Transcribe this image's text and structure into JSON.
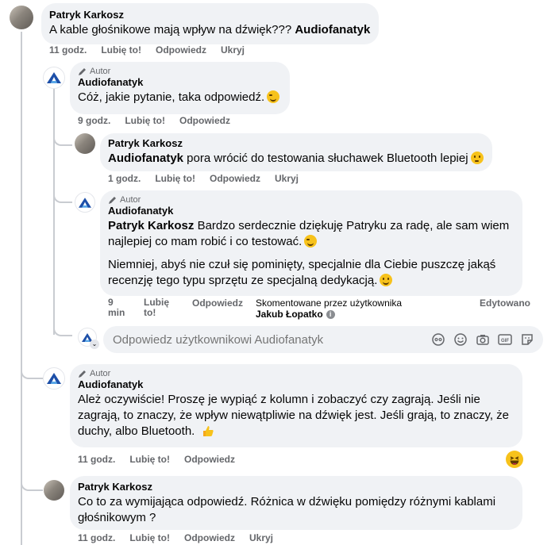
{
  "colors": {
    "bubble": "#f0f2f5",
    "meta": "#65676b",
    "thread_line": "#c9ccd1",
    "brand_blue": "#1d4fa8",
    "emoji": "#f7c21b"
  },
  "comments": [
    {
      "author": "Patryk Karkosz",
      "text": "A kable głośnikowe mają wpływ na dźwięk??? ",
      "mention": "Audiofanatyk",
      "time": "11 godz.",
      "like": "Lubię to!",
      "reply": "Odpowiedz",
      "hide": "Ukryj"
    },
    {
      "badge": "Autor",
      "author": "Audiofanatyk",
      "text": "Cóż, jakie pytanie, taka odpowiedź.",
      "time": "9 godz.",
      "like": "Lubię to!",
      "reply": "Odpowiedz"
    },
    {
      "author": "Patryk Karkosz",
      "mention": "Audiofanatyk",
      "text": " pora wrócić do testowania słuchawek Bluetooth lepiej",
      "time": "1 godz.",
      "like": "Lubię to!",
      "reply": "Odpowiedz",
      "hide": "Ukryj"
    },
    {
      "badge": "Autor",
      "author": "Audiofanatyk",
      "mention": "Patryk Karkosz",
      "text_line1": " Bardzo serdecznie dziękuję Patryku za radę, ale sam wiem",
      "text_line2": "najlepiej co mam robić i co testować.",
      "text_p2_line1": "Niemniej, abyś nie czuł się pominięty, specjalnie dla Ciebie puszczę jakąś",
      "text_p2_line2": "recenzję tego typu sprzętu ze specjalną dedykacją.",
      "time_line1": "9",
      "time_line2": "min",
      "like_line1": "Lubię",
      "like_line2": "to!",
      "reply": "Odpowiedz",
      "commented_by": "Skomentowane przez użytkownika",
      "commented_by_name": "Jakub Łopatko",
      "edited": "Edytowano"
    },
    {
      "badge": "Autor",
      "author": "Audiofanatyk",
      "text_line1": "Ależ oczywiście! Proszę je wypiąć z kolumn i zobaczyć czy zagrają. Jeśli nie",
      "text_line2": "zagrają, to znaczy, że wpływ niewątpliwie na dźwięk jest. Jeśli grają, to znaczy, że",
      "text_line3": "duchy, albo Bluetooth.",
      "time": "11 godz.",
      "like": "Lubię to!",
      "reply": "Odpowiedz"
    },
    {
      "author": "Patryk Karkosz",
      "text_line1": "Co to za wymijająca odpowiedź. Różnica w dźwięku pomiędzy różnymi kablami",
      "text_line2": "głośnikowym ?",
      "time": "11 godz.",
      "like": "Lubię to!",
      "reply": "Odpowiedz",
      "hide": "Ukryj"
    }
  ],
  "reply_input": {
    "placeholder": "Odpowiedz użytkownikowi Audiofanatyk"
  },
  "icons": [
    "audiofanatyk-logo-icon",
    "pencil-icon",
    "info-icon",
    "avatar-sticker-icon",
    "emoji-icon",
    "camera-icon",
    "gif-icon",
    "sticker-icon",
    "thumbs-up-emoji-icon",
    "laughing-reaction-icon"
  ]
}
